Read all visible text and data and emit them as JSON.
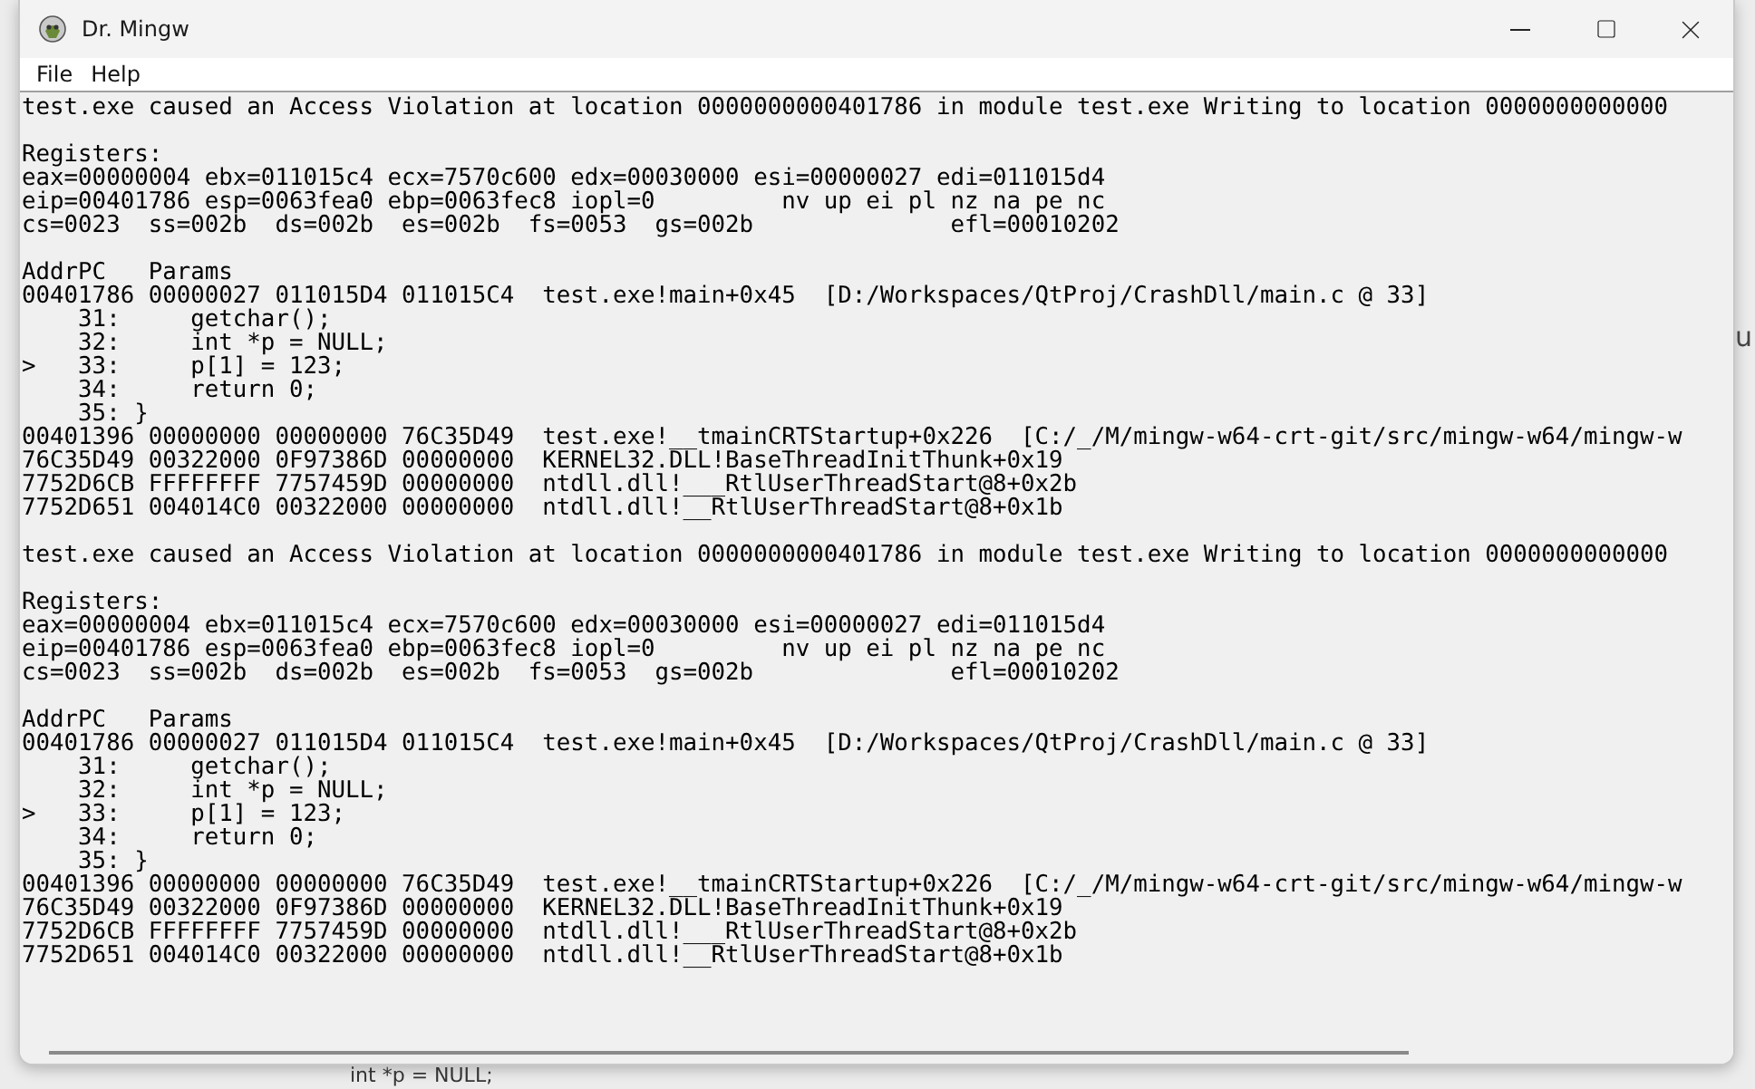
{
  "window": {
    "title": "Dr. Mingw"
  },
  "menu": [
    "File",
    "Help"
  ],
  "log_paragraphs": [
    [
      "test.exe caused an Access Violation at location 0000000000401786 in module test.exe Writing to location 0000000000000"
    ],
    [
      "Registers:",
      "eax=00000004 ebx=011015c4 ecx=7570c600 edx=00030000 esi=00000027 edi=011015d4",
      "eip=00401786 esp=0063fea0 ebp=0063fec8 iopl=0         nv up ei pl nz na pe nc",
      "cs=0023  ss=002b  ds=002b  es=002b  fs=0053  gs=002b              efl=00010202"
    ],
    [
      "AddrPC   Params",
      "00401786 00000027 011015D4 011015C4  test.exe!main+0x45  [D:/Workspaces/QtProj/CrashDll/main.c @ 33]",
      "    31:     getchar();",
      "    32:     int *p = NULL;",
      ">   33:     p[1] = 123;",
      "    34:     return 0;",
      "    35: }",
      "00401396 00000000 00000000 76C35D49  test.exe!__tmainCRTStartup+0x226  [C:/_/M/mingw-w64-crt-git/src/mingw-w64/mingw-w",
      "76C35D49 00322000 0F97386D 00000000  KERNEL32.DLL!BaseThreadInitThunk+0x19",
      "7752D6CB FFFFFFFF 7757459D 00000000  ntdll.dll!___RtlUserThreadStart@8+0x2b",
      "7752D651 004014C0 00322000 00000000  ntdll.dll!__RtlUserThreadStart@8+0x1b"
    ],
    [
      "test.exe caused an Access Violation at location 0000000000401786 in module test.exe Writing to location 0000000000000"
    ],
    [
      "Registers:",
      "eax=00000004 ebx=011015c4 ecx=7570c600 edx=00030000 esi=00000027 edi=011015d4",
      "eip=00401786 esp=0063fea0 ebp=0063fec8 iopl=0         nv up ei pl nz na pe nc",
      "cs=0023  ss=002b  ds=002b  es=002b  fs=0053  gs=002b              efl=00010202"
    ],
    [
      "AddrPC   Params",
      "00401786 00000027 011015D4 011015C4  test.exe!main+0x45  [D:/Workspaces/QtProj/CrashDll/main.c @ 33]",
      "    31:     getchar();",
      "    32:     int *p = NULL;",
      ">   33:     p[1] = 123;",
      "    34:     return 0;",
      "    35: }",
      "00401396 00000000 00000000 76C35D49  test.exe!__tmainCRTStartup+0x226  [C:/_/M/mingw-w64-crt-git/src/mingw-w64/mingw-w",
      "76C35D49 00322000 0F97386D 00000000  KERNEL32.DLL!BaseThreadInitThunk+0x19",
      "7752D6CB FFFFFFFF 7757459D 00000000  ntdll.dll!___RtlUserThreadStart@8+0x2b",
      "7752D651 004014C0 00322000 00000000  ntdll.dll!__RtlUserThreadStart@8+0x1b"
    ]
  ],
  "background_editor": {
    "side_text": "u",
    "code_line": "int *p = NULL;"
  }
}
